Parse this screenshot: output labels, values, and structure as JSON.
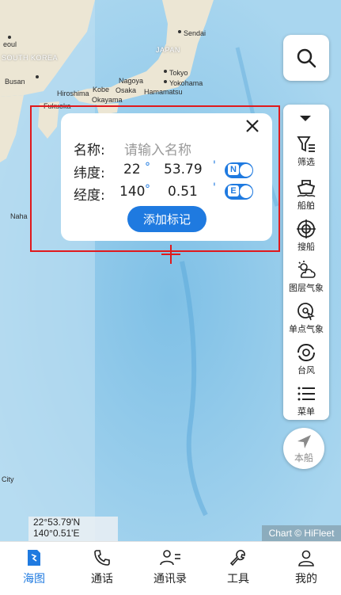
{
  "map": {
    "labels": {
      "korea": "SOUTH KOREA",
      "japan": "JAPAN",
      "seoul": "Seoul",
      "busan": "Busan",
      "sendai": "Sendai",
      "tokyo": "Tokyo",
      "yokohama": "Yokohama",
      "nagoya": "Nagoya",
      "kobe": "Kobe",
      "osaka": "Osaka",
      "hamamatsu": "Hamamatsu",
      "hiroshima": "Hiroshima",
      "okayama": "Okayama",
      "fukuoka": "Fukuoka",
      "naha": "Naha",
      "city": "City",
      "seoul_partial": "eoul"
    },
    "coord_readout": {
      "lat": "22°53.79'N",
      "lon": "140°0.51'E"
    },
    "copyright": "Chart © HiFleet"
  },
  "toolbar": {
    "items": [
      {
        "label": "筛选",
        "icon": "filter-icon"
      },
      {
        "label": "船舶",
        "icon": "ship-icon"
      },
      {
        "label": "搜船",
        "icon": "target-icon"
      },
      {
        "label": "图层气象",
        "icon": "weather-layer-icon"
      },
      {
        "label": "单点气象",
        "icon": "point-weather-icon"
      },
      {
        "label": "台风",
        "icon": "typhoon-icon"
      },
      {
        "label": "菜单",
        "icon": "menu-icon"
      }
    ]
  },
  "ship_button": {
    "label": "本船"
  },
  "dialog": {
    "name_label": "名称:",
    "name_placeholder": "请输入名称",
    "lat_label": "纬度:",
    "lat_deg": "22",
    "lat_min": "53.79",
    "lat_hemisphere": "N",
    "lon_label": "经度:",
    "lon_deg": "140",
    "lon_min": "0.51",
    "lon_hemisphere": "E",
    "degree_symbol": "°",
    "minute_symbol": "'",
    "add_button": "添加标记"
  },
  "tabs": [
    {
      "label": "海图",
      "icon": "chart-map-icon",
      "active": true
    },
    {
      "label": "通话",
      "icon": "phone-icon",
      "active": false
    },
    {
      "label": "通讯录",
      "icon": "contacts-icon",
      "active": false
    },
    {
      "label": "工具",
      "icon": "tools-icon",
      "active": false
    },
    {
      "label": "我的",
      "icon": "profile-icon",
      "active": false
    }
  ],
  "colors": {
    "accent": "#1f7ae0",
    "marker": "#e0191c",
    "sea": "#cfe6f3",
    "land": "#e9e4d2"
  }
}
